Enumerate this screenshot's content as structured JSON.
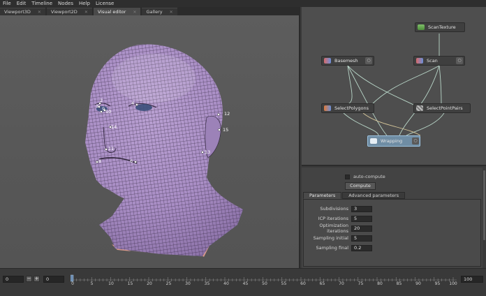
{
  "menu": [
    "File",
    "Edit",
    "Timeline",
    "Nodes",
    "Help",
    "License"
  ],
  "tabs": [
    {
      "label": "Viewport3D",
      "active": false
    },
    {
      "label": "Viewport2D",
      "active": false
    },
    {
      "label": "Visual editor",
      "active": true
    },
    {
      "label": "Gallery",
      "active": false
    }
  ],
  "viewport": {
    "landmarks": [
      "2",
      "3",
      "4",
      "9",
      "10",
      "12",
      "14",
      "15",
      "11",
      "13",
      "8",
      "6"
    ]
  },
  "nodes": {
    "scantexture": "ScanTexture",
    "basemesh": "Basemesh",
    "scan": "Scan",
    "selectpolygons": "SelectPolygons",
    "selectpointpairs": "SelectPointPairs",
    "wrapping": "Wrapping"
  },
  "props": {
    "autocompute_label": "auto-compute",
    "compute_label": "Compute",
    "tabs": [
      "Parameters",
      "Advanced parameters"
    ],
    "rows": [
      {
        "label": "Subdivisions",
        "value": "3"
      },
      {
        "label": "ICP iterations",
        "value": "5"
      },
      {
        "label": "Optimization iterations",
        "value": "20"
      },
      {
        "label": "Sampling initial",
        "value": "5"
      },
      {
        "label": "Sampling final",
        "value": "0.2"
      }
    ]
  },
  "timeline": {
    "start": "0",
    "current": "0",
    "end": "100",
    "minus": "−",
    "plus": "+",
    "ticks": [
      "0",
      "5",
      "10",
      "15",
      "20",
      "25",
      "30",
      "35",
      "40",
      "45",
      "50",
      "55",
      "60",
      "65",
      "70",
      "75",
      "80",
      "85",
      "90",
      "95",
      "100"
    ]
  },
  "colors": {
    "mesh": "#a98dc4",
    "wire": "#2a2035",
    "selected_node": "#6f8da4",
    "edge": "#b9d7c9"
  }
}
